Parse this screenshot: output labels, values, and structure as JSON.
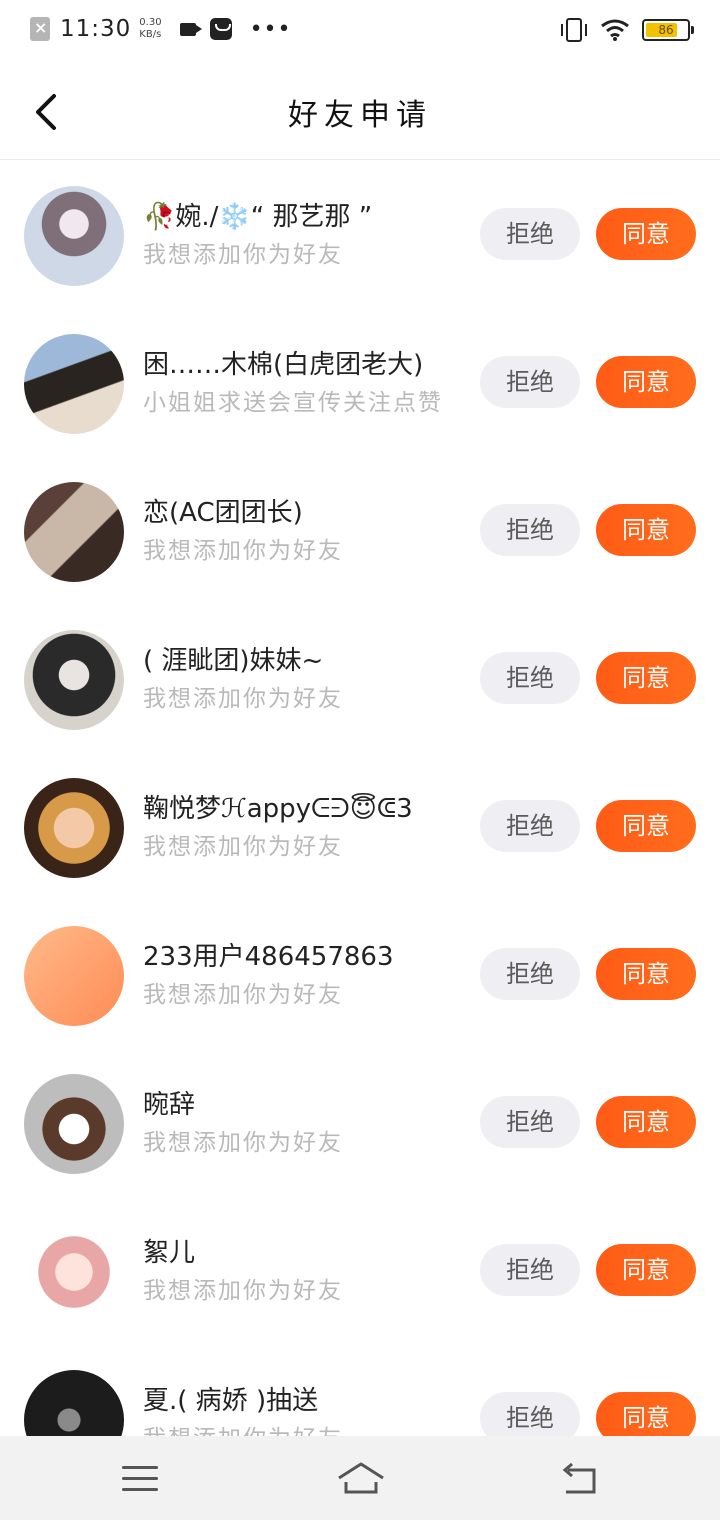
{
  "status_bar": {
    "time": "11:30",
    "speed_value": "0.30",
    "speed_unit": "KB/s",
    "more": "•••",
    "battery": "86",
    "battery_level": 0.86,
    "icons": [
      "notification-x-icon",
      "video-icon",
      "message-icon",
      "vibrate-icon",
      "wifi-icon",
      "battery-icon"
    ]
  },
  "header": {
    "title": "好友申请",
    "back_icon": "chevron-left-icon"
  },
  "actions": {
    "reject_label": "拒绝",
    "accept_label": "同意"
  },
  "colors": {
    "accent": "#ff5a14",
    "reject_bg": "#efeff3",
    "message_gray": "#b9b9b9"
  },
  "requests": [
    {
      "name": "🥀婉./❄️“ 那艺那 ”",
      "message": "我想添加你为好友"
    },
    {
      "name": "困……木棉(白虎团老大)",
      "message": "小姐姐求送会宣传关注点赞"
    },
    {
      "name": "恋(AC团团长)",
      "message": "我想添加你为好友"
    },
    {
      "name": "( 涯眦团)妹妹~",
      "message": "我想添加你为好友"
    },
    {
      "name": "鞠悦梦ℋappyᕮᕭ😇ᕳ3",
      "message": "我想添加你为好友"
    },
    {
      "name": "233用户486457863",
      "message": "我想添加你为好友"
    },
    {
      "name": "晼辞",
      "message": "我想添加你为好友"
    },
    {
      "name": "絮儿",
      "message": "我想添加你为好友"
    },
    {
      "name": "夏.( 病娇 )抽送",
      "message": "我想添加你为好友"
    }
  ],
  "nav_bar": {
    "icons": [
      "menu-icon",
      "home-icon",
      "back-icon"
    ]
  }
}
